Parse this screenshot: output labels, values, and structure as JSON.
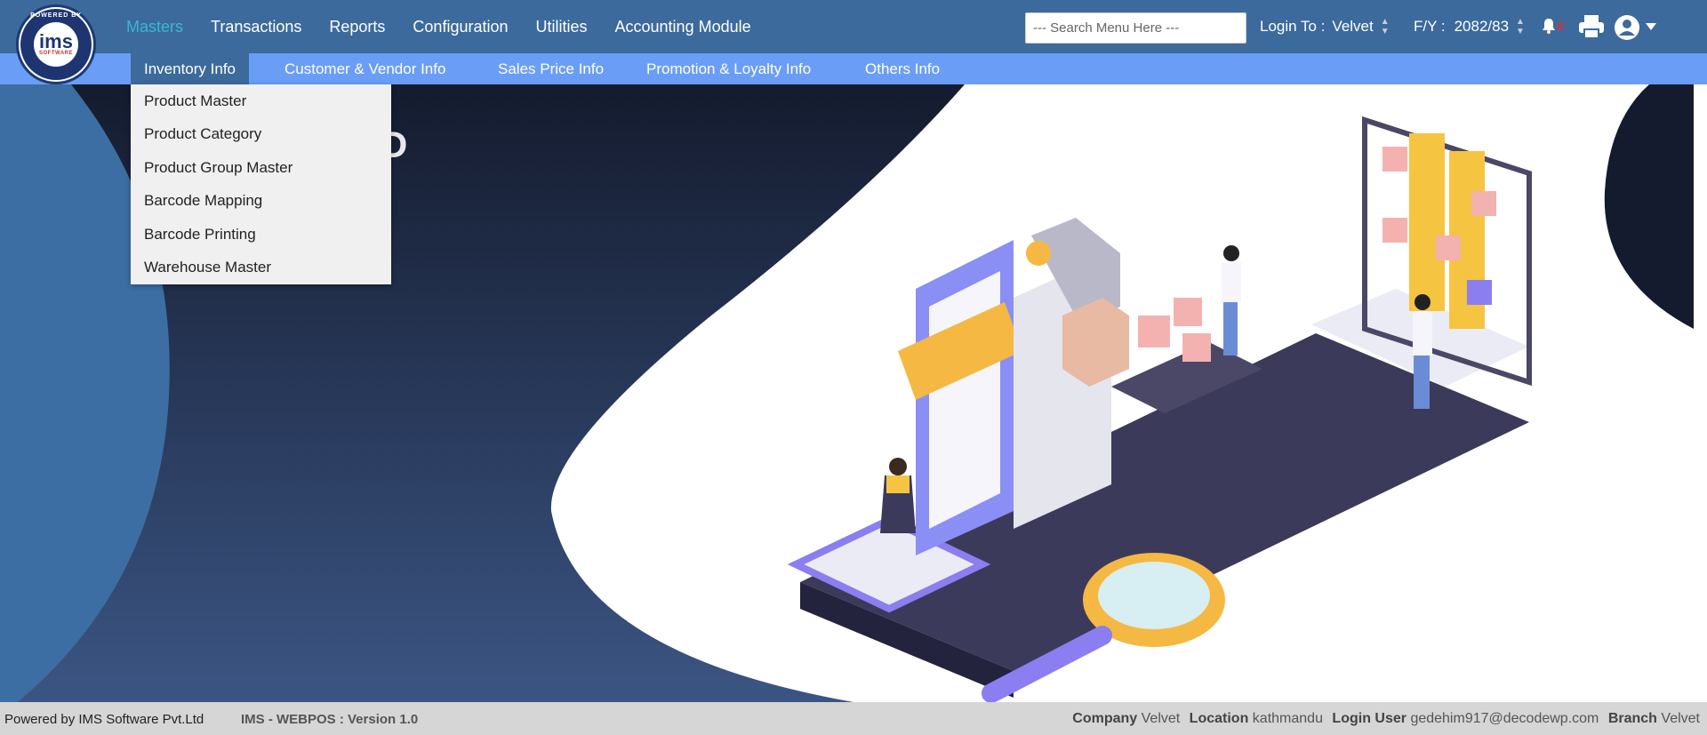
{
  "logo": {
    "text": "ims",
    "sub": "SOFTWARE",
    "arc": "POWERED BY"
  },
  "mainnav": [
    "Masters",
    "Transactions",
    "Reports",
    "Configuration",
    "Utilities",
    "Accounting Module"
  ],
  "search": {
    "placeholder": "--- Search Menu Here ---"
  },
  "login": {
    "label": "Login To :",
    "value": "Velvet"
  },
  "fy": {
    "label": "F/Y :",
    "value": "2082/83"
  },
  "notifications": {
    "count": "0"
  },
  "subnav": [
    "Inventory Info",
    "Customer & Vendor Info",
    "Sales Price Info",
    "Promotion & Loyalty Info",
    "Others Info"
  ],
  "dropdown": [
    "Product Master",
    "Product Category",
    "Product Group Master",
    "Barcode Mapping",
    "Barcode Printing",
    "Warehouse Master"
  ],
  "hero": {
    "partial_text": "D"
  },
  "footer": {
    "powered": "Powered by IMS Software Pvt.Ltd",
    "version": "IMS - WEBPOS : Version 1.0",
    "company_label": "Company",
    "company": "Velvet",
    "location_label": "Location",
    "location": "kathmandu",
    "user_label": "Login User",
    "user": "gedehim917@decodewp.com",
    "branch_label": "Branch",
    "branch": "Velvet"
  },
  "colors": {
    "header": "#3c6a9c",
    "subnav": "#6a9df6",
    "active_nav": "#39b8d4",
    "footer": "#d6d6d6"
  }
}
